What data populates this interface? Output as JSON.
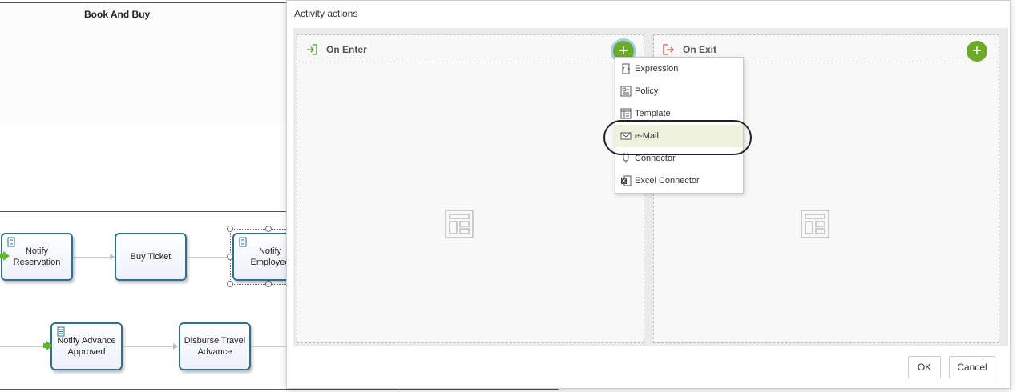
{
  "diagram": {
    "lane_title": "Book And Buy",
    "tasks": [
      {
        "label": "Notify Reservation"
      },
      {
        "label": "Buy Ticket"
      },
      {
        "label": "Notify Employee"
      },
      {
        "label": "Notify Advance Approved"
      },
      {
        "label": "Disburse Travel Advance"
      }
    ]
  },
  "dialog": {
    "title": "Activity actions",
    "on_enter": {
      "label": "On Enter",
      "add_label": "+"
    },
    "on_exit": {
      "label": "On Exit",
      "add_label": "+"
    },
    "ok_label": "OK",
    "cancel_label": "Cancel"
  },
  "menu": {
    "items": [
      {
        "label": "Expression",
        "icon": "expression-icon"
      },
      {
        "label": "Policy",
        "icon": "policy-icon"
      },
      {
        "label": "Template",
        "icon": "template-icon"
      },
      {
        "label": "e-Mail",
        "icon": "mail-icon",
        "highlighted": true
      },
      {
        "label": "Connector",
        "icon": "connector-icon"
      },
      {
        "label": "Excel Connector",
        "icon": "excel-icon"
      }
    ]
  },
  "colors": {
    "accent_green": "#6da92b",
    "task_border": "#2f6f8f",
    "start_marker": "#5cb82e",
    "enter_icon": "#4a9a3a",
    "exit_icon": "#d9534f"
  }
}
